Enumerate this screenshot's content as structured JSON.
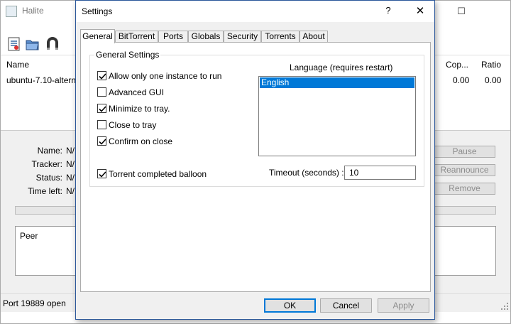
{
  "main_window": {
    "title": "Halite",
    "minimize_glyph": "—",
    "maximize_glyph": "☐",
    "toolbar": {
      "icons": [
        "open-file-icon",
        "open-folder-icon",
        "magnet-icon"
      ]
    },
    "columns": {
      "name": "Name",
      "copies": "Cop...",
      "ratio": "Ratio"
    },
    "torrent_row": {
      "name": "ubuntu-7.10-altern",
      "copies": "0.00",
      "ratio": "0.00"
    },
    "details": {
      "name_label": "Name:",
      "name_value": "N/",
      "tracker_label": "Tracker:",
      "tracker_value": "N/",
      "status_label": "Status:",
      "status_value": "N/",
      "time_left_label": "Time left:",
      "time_left_value": "N/"
    },
    "buttons": {
      "pause": "Pause",
      "reannounce": "Reannounce",
      "remove": "Remove"
    },
    "peers_header": "Peer",
    "status": "Port 19889 open"
  },
  "dialog": {
    "title": "Settings",
    "help_glyph": "?",
    "close_glyph": "✕",
    "tabs": [
      "General",
      "BitTorrent",
      "Ports",
      "Globals",
      "Security",
      "Torrents",
      "About"
    ],
    "group_title": "General Settings",
    "checkboxes": [
      {
        "label": "Allow only one instance to run",
        "checked": true
      },
      {
        "label": "Advanced GUI",
        "checked": false
      },
      {
        "label": "Minimize to tray.",
        "checked": true
      },
      {
        "label": "Close to tray",
        "checked": false
      },
      {
        "label": "Confirm on close",
        "checked": true
      },
      {
        "label": "Torrent completed balloon",
        "checked": true
      }
    ],
    "language_label": "Language (requires restart)",
    "languages": [
      "English"
    ],
    "selected_language": "English",
    "timeout_label": "Timeout (seconds) :",
    "timeout_value": "10",
    "buttons": {
      "ok": "OK",
      "cancel": "Cancel",
      "apply": "Apply"
    }
  },
  "colors": {
    "selection": "#0078d7",
    "dialog_bg": "#f0f0f0",
    "accent_border": "#2b579a"
  }
}
